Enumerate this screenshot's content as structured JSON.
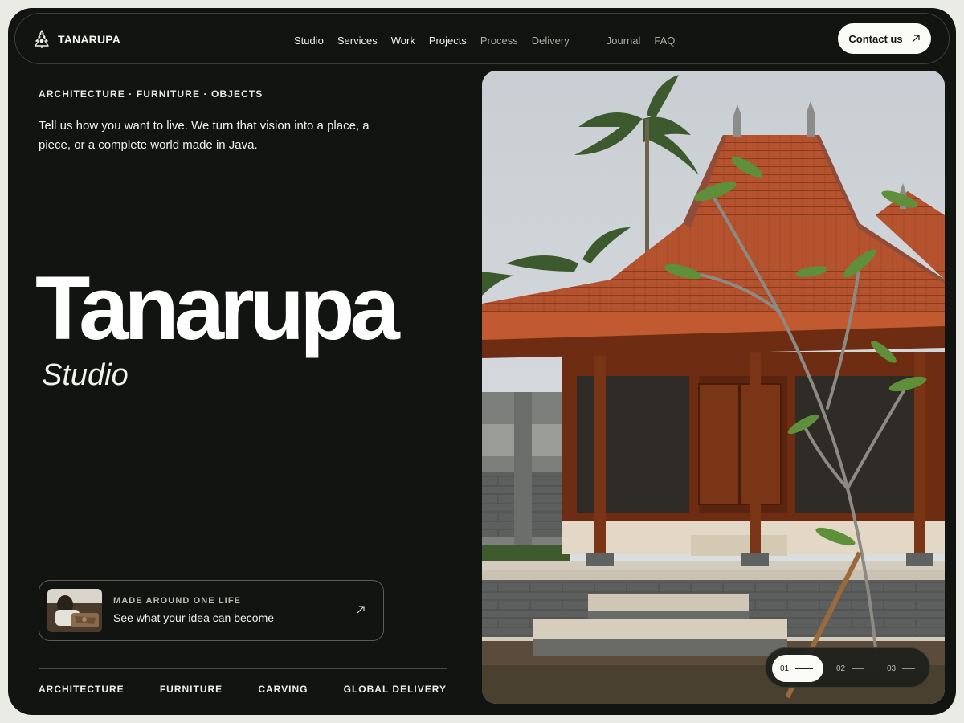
{
  "brand": {
    "name": "TANARUPA",
    "icon": "temple-crest-icon"
  },
  "nav": {
    "links": [
      {
        "label": "Studio",
        "active": true
      },
      {
        "label": "Services"
      },
      {
        "label": "Work"
      },
      {
        "label": "Projects"
      },
      {
        "label": "Process",
        "muted": true
      },
      {
        "label": "Delivery",
        "muted": true
      }
    ],
    "secondary": [
      {
        "label": "Journal"
      },
      {
        "label": "FAQ"
      }
    ],
    "contact_label": "Contact us",
    "contact_icon": "arrow-up-right-icon"
  },
  "hero": {
    "eyebrow": "ARCHITECTURE · FURNITURE · OBJECTS",
    "lede": "Tell us how you want to live. We turn that vision into a place, a piece, or a complete world made in Java.",
    "title": "Tanarupa",
    "subtitle": "Studio"
  },
  "promo": {
    "kicker": "MADE AROUND ONE LIFE",
    "text": "See what your idea can become",
    "icon": "arrow-up-right-icon"
  },
  "tags": [
    "ARCHITECTURE",
    "FURNITURE",
    "CARVING",
    "GLOBAL DELIVERY"
  ],
  "slider": {
    "items": [
      "01",
      "02",
      "03"
    ],
    "active_index": 0
  },
  "colors": {
    "frame": "#121411",
    "page": "#ebebe6",
    "roof": "#b4532f",
    "wood": "#7a3416",
    "button": "#fafaf6"
  }
}
